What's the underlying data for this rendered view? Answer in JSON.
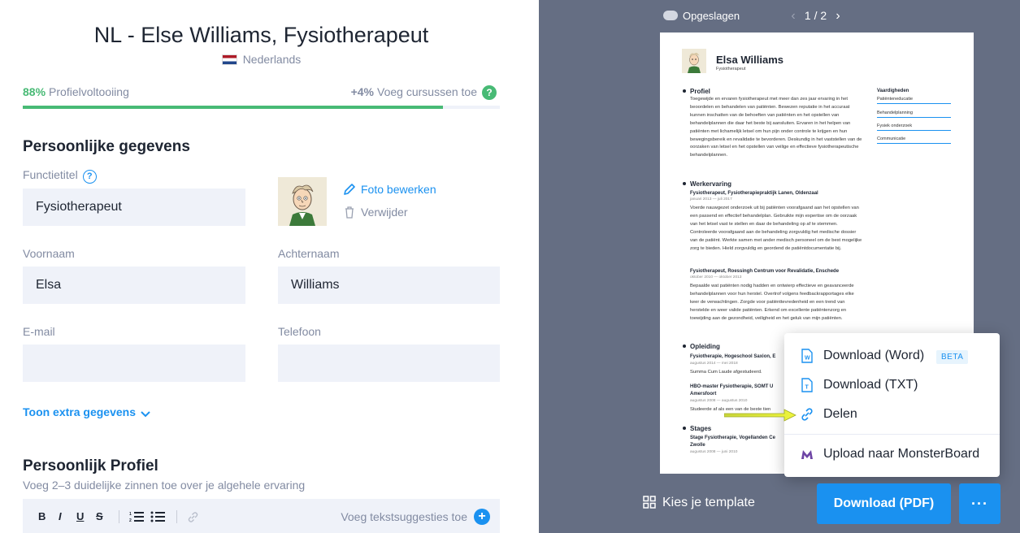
{
  "editor": {
    "document_title": "NL - Else Williams, Fysiotherapeut",
    "language": "Nederlands",
    "progress": {
      "percent_label": "88%",
      "label": "Profielvoltooiing",
      "fraction": 0.88,
      "bonus": "+4%",
      "bonus_label": "Voeg cursussen toe",
      "help": "?"
    },
    "personal": {
      "title": "Persoonlijke gegevens",
      "job_title_label": "Functietitel",
      "job_title_value": "Fysiotherapeut",
      "help": "?",
      "photo_edit": "Foto bewerken",
      "photo_delete": "Verwijder",
      "first_name_label": "Voornaam",
      "first_name_value": "Elsa",
      "last_name_label": "Achternaam",
      "last_name_value": "Williams",
      "email_label": "E-mail",
      "email_value": "",
      "phone_label": "Telefoon",
      "phone_value": "",
      "extra": "Toon extra gegevens"
    },
    "profile": {
      "title": "Persoonlijk Profiel",
      "subtitle": "Voeg 2–3 duidelijke zinnen toe over je algehele ervaring",
      "toolbar": {
        "bold": "B",
        "italic": "I",
        "underline": "U",
        "strike": "S",
        "suggest": "Voeg tekstsuggesties toe",
        "plus": "+"
      }
    }
  },
  "preview": {
    "saved": "Opgeslagen",
    "page_indicator": "1 / 2",
    "prev": "‹",
    "next": "›",
    "cv": {
      "name": "Elsa Williams",
      "title": "Fysiotherapeut",
      "profile_heading": "Profiel",
      "profile_text": "Toegewijde en ervaren fysiotherapeut met meer dan zes jaar ervaring in het beoordelen en behandelen van patiënten. Bewezen reputatie in het accuraat kunnen inschatten van de behoeften van patiënten en het opstellen van behandelplannen die daar het beste bij aansluiten. Ervaren in het helpen van patiënten met lichamelijk letsel om hun pijn onder controle te krijgen en hun bewegingsbereik en revalidatie te bevorderen. Deskundig in het vaststellen van de oorzaken van letsel en het opstellen van veilige en effectieve fysiotherapeutische behandelplannen.",
      "experience_heading": "Werkervaring",
      "job1_title": "Fysiotherapeut, Fysiotherapiepraktijk Lanen, Oldenzaal",
      "job1_date": "januari 2013 — juli 2017",
      "job1_text": "Voerde nauwgezet onderzoek uit bij patiënten voorafgaand aan het opstellen van een passend en effectief behandelplan. Gebruikte mijn expertise om de oorzaak van het letsel vast te stellen en daar de behandeling op af te stemmen. Controleerde voorafgaand aan de behandeling zorgvuldig het medische dossier van de patiënt. Werkte samen met ander medisch personeel om de best mogelijke zorg te bieden. Hield zorgvuldig en geordend de patiëntdocumentatie bij.",
      "job2_title": "Fysiotherapeut, Roessingh Centrum voor Revalidatie, Enschede",
      "job2_date": "oktober 2010 — oktober 2013",
      "job2_text": "Bepaalde wat patiënten nodig hadden en ontwierp effectieve en geavanceerde behandelplannen voor hun herstel. Overtrof volgens feedbackrapportages elke keer de verwachtingen. Zorgde voor patiënttevredenheid en een trend van herstelde en weer valide patiënten. Erkend om excellente patiëntenzorg en toewijding aan de gezondheid, veiligheid en het geluk van mijn patiënten.",
      "education_heading": "Opleiding",
      "edu1_title": "Fysiotherapie, Hogeschool Saxion, E",
      "edu1_date": "augustus 2014 — mei 2018",
      "edu1_text": "Summa Cum Laude afgestudeerd.",
      "edu2_title": "HBO-master Fysiotherapie, SOMT U",
      "edu2_title2": "Amersfoort",
      "edu2_date": "augustus 2008 — augustus 2010",
      "edu2_text": "Studeerde af als een van de beste tien",
      "internship_heading": "Stages",
      "intern1_title": "Stage Fysiotherapie, Vogellanden Ce",
      "intern1_title2": "Zwolle",
      "intern1_date": "augustus 2008 — juni 2010",
      "skills_heading": "Vaardigheden",
      "skills": [
        "Patiënteneducatie",
        "Behandelplanning",
        "Fysiek onderzoek",
        "Communicatie"
      ]
    },
    "menu": {
      "word": "Download (Word)",
      "beta": "BETA",
      "txt": "Download (TXT)",
      "share": "Delen",
      "monster": "Upload naar MonsterBoard"
    },
    "choose_template": "Kies je template",
    "download_pdf": "Download (PDF)",
    "more": "···"
  },
  "colors": {
    "accent": "#1a91f0",
    "success": "#48ba75",
    "preview_bg": "#656e83",
    "field_bg": "#eff2f9",
    "arrow": "#e4f23a"
  }
}
